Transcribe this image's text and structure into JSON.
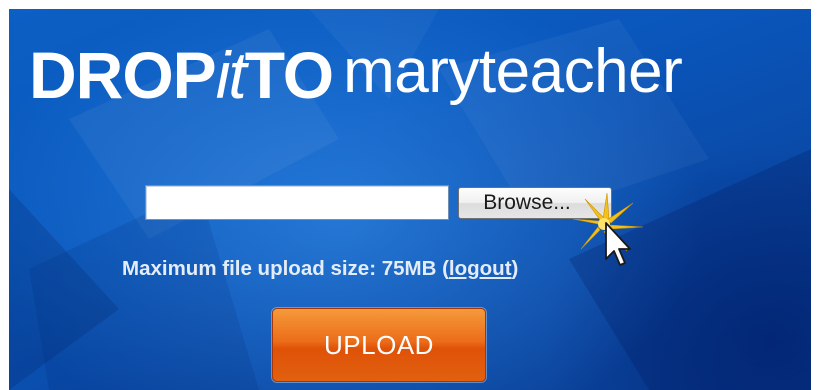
{
  "header": {
    "logo_drop": "DROP",
    "logo_it": "it",
    "logo_to": "TO",
    "username": "maryteacher"
  },
  "upload_form": {
    "file_value": "",
    "browse_label": "Browse...",
    "limit_prefix": "Maximum file upload size: 75MB (",
    "logout_label": "logout",
    "limit_suffix": ")",
    "upload_label": "UPLOAD"
  },
  "colors": {
    "background": "#0a58be",
    "upload_button": "#ec6d1a",
    "text": "#ffffff"
  },
  "icons": {
    "cursor": "arrow-cursor-with-click-burst"
  }
}
